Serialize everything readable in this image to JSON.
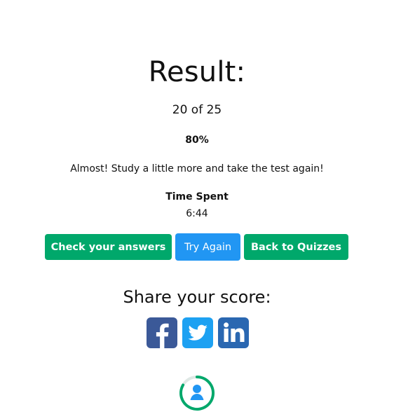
{
  "result": {
    "title": "Result:",
    "score_text": "20 of 25",
    "percent_text": "80%",
    "message": "Almost! Study a little more and take the test again!",
    "time_label": "Time Spent",
    "time_value": "6:44"
  },
  "actions": {
    "check_answers": "Check your answers",
    "try_again": "Try Again",
    "back_to_quizzes": "Back to Quizzes"
  },
  "share": {
    "title": "Share your score:",
    "icons": [
      "facebook-icon",
      "twitter-icon",
      "linkedin-icon"
    ]
  },
  "colors": {
    "accent_green": "#00a86b",
    "accent_blue": "#2196f3",
    "facebook_blue": "#3b5998",
    "twitter_blue": "#1da1f2",
    "linkedin_blue": "#2a67b1"
  }
}
